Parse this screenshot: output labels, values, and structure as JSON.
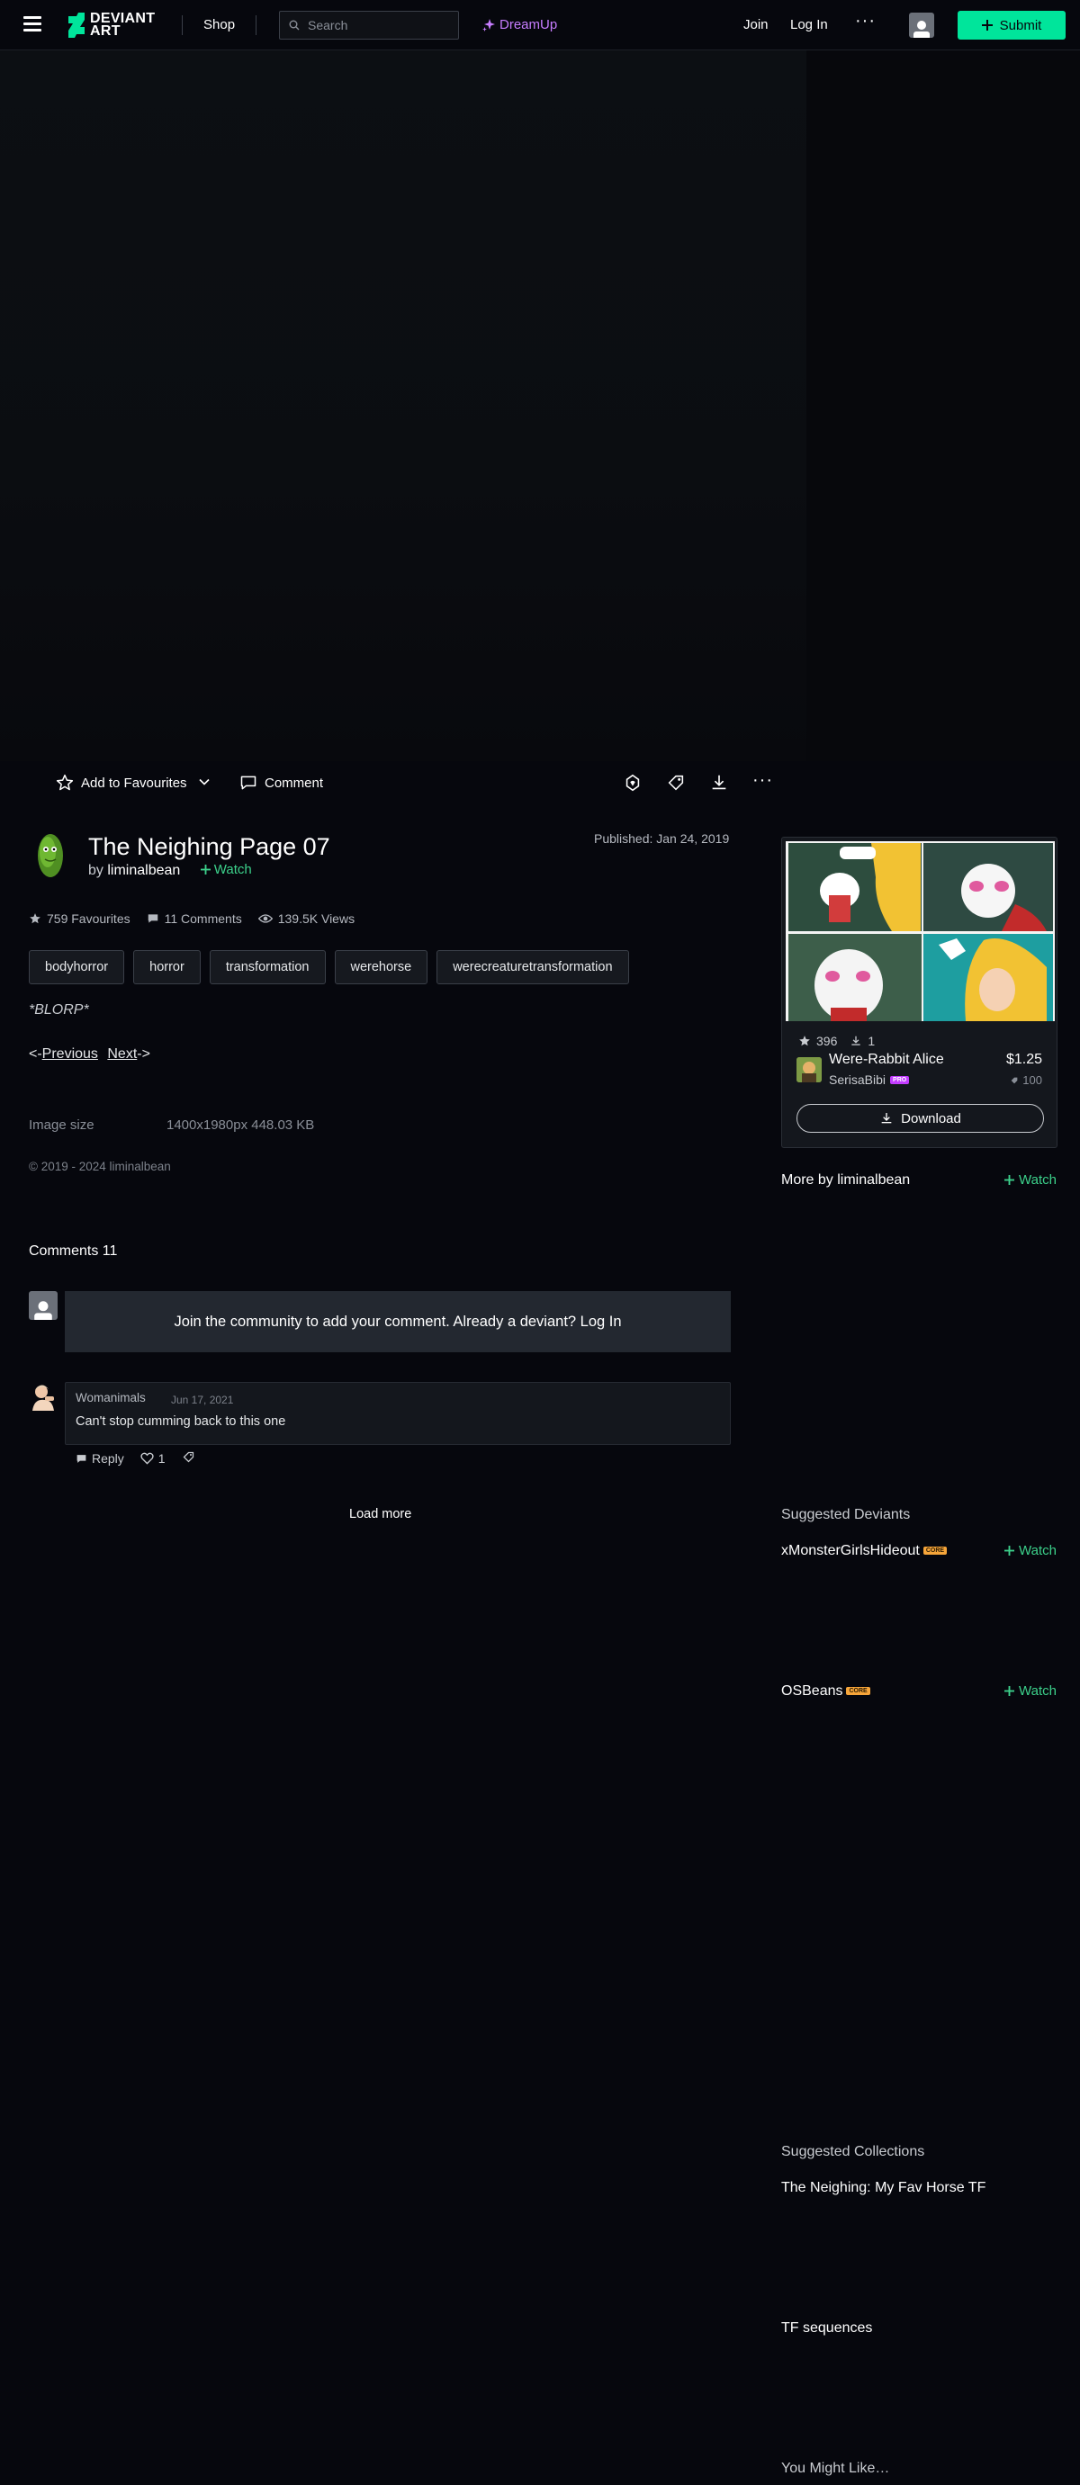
{
  "header": {
    "logo_text_1": "DEVIANT",
    "logo_text_2": "ART",
    "shop": "Shop",
    "search_placeholder": "Search",
    "dreamup": "DreamUp",
    "join": "Join",
    "login": "Log In",
    "submit": "Submit"
  },
  "actions": {
    "add_to_favourites": "Add to Favourites",
    "comment": "Comment"
  },
  "deviation": {
    "title": "The Neighing Page 07",
    "by": "by",
    "author": "liminalbean",
    "watch": "Watch",
    "published": "Published: Jan 24, 2019",
    "favourites": "759 Favourites",
    "comments": "11 Comments",
    "views": "139.5K Views",
    "tags": [
      "bodyhorror",
      "horror",
      "transformation",
      "werehorse",
      "werecreaturetransformation"
    ],
    "description": "*BLORP*",
    "prev_prefix": "<-",
    "previous": "Previous",
    "next": "Next",
    "next_suffix": "->",
    "image_size_label": "Image size",
    "image_size_value": "1400x1980px 448.03 KB",
    "copyright": "© 2019 - 2024 liminalbean"
  },
  "comments": {
    "heading": "Comments 11",
    "join_text": "Join the community to add your comment. Already a deviant? Log In",
    "items": [
      {
        "author": "Womanimals",
        "date": "Jun 17, 2021",
        "text": "Can't stop cumming back to this one",
        "reply": "Reply",
        "likes": "1"
      }
    ],
    "load_more": "Load more"
  },
  "sidebar": {
    "card": {
      "favourites": "396",
      "downloads": "1",
      "title": "Were-Rabbit Alice",
      "user": "SerisaBibi",
      "price": "$1.25",
      "points": "100",
      "download": "Download",
      "badge": "PRO"
    },
    "more_by": "More by liminalbean",
    "watch": "Watch",
    "suggested_deviants": "Suggested Deviants",
    "deviants": [
      {
        "name": "xMonsterGirlsHideout",
        "badge": "CORE"
      },
      {
        "name": "OSBeans",
        "badge": "CORE"
      }
    ],
    "suggested_collections": "Suggested Collections",
    "collections": [
      "The Neighing: My Fav Horse TF",
      "TF sequences"
    ],
    "you_might_like": "You Might Like…"
  },
  "colors": {
    "background": "#06070d",
    "accent_green": "#00e59b",
    "watch_green": "#3cd18b",
    "dreamup_purple": "#c77dff"
  }
}
